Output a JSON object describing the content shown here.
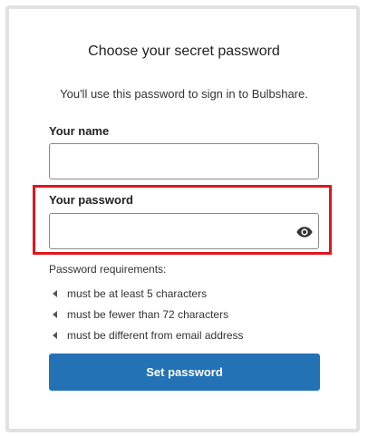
{
  "form": {
    "title": "Choose your secret password",
    "subtitle": "You'll use this password to sign in to Bulbshare.",
    "name_label": "Your name",
    "name_value": "",
    "password_label": "Your password",
    "password_value": "",
    "requirements_heading": "Password requirements:",
    "requirements": [
      "must be at least 5 characters",
      "must be fewer than 72 characters",
      "must be different from email address"
    ],
    "submit_label": "Set password"
  },
  "icons": {
    "toggle_visibility": "eye-icon",
    "requirement_bullet": "caret-left-icon"
  },
  "colors": {
    "primary_button": "#2372b6",
    "highlight_border": "#e0161c",
    "frame_border": "#e1e1e1"
  }
}
